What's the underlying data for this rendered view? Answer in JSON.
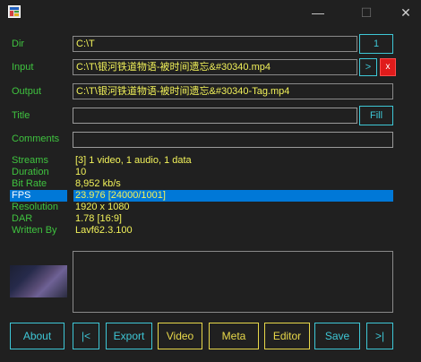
{
  "window": {
    "minimize_glyph": "—",
    "maximize_glyph": "☐",
    "close_glyph": "✕"
  },
  "form": {
    "dir": {
      "label": "Dir",
      "value": "C:\\T",
      "button": "1"
    },
    "input": {
      "label": "Input",
      "value": "C:\\T\\银河铁道物语-被时间遗忘&#30340.mp4",
      "next_button": ">",
      "clear_button": "x"
    },
    "output": {
      "label": "Output",
      "value": "C:\\T\\银河铁道物语-被时间遗忘&#30340-Tag.mp4"
    },
    "title": {
      "label": "Title",
      "value": "",
      "button": "Fill"
    },
    "comments": {
      "label": "Comments",
      "value": ""
    }
  },
  "info": [
    {
      "key": "Streams",
      "value": "[3]  1 video, 1 audio, 1 data"
    },
    {
      "key": "Duration",
      "value": "10"
    },
    {
      "key": "Bit Rate",
      "value": "8,952 kb/s"
    },
    {
      "key": "FPS",
      "value": "23.976  [24000/1001]",
      "selected": true
    },
    {
      "key": "Resolution",
      "value": "1920 x 1080"
    },
    {
      "key": "DAR",
      "value": "1.78  [16:9]"
    },
    {
      "key": "Written By",
      "value": "Lavf62.3.100"
    }
  ],
  "buttons": {
    "about": "About",
    "prev": "|<",
    "export": "Export",
    "video": "Video",
    "meta": "Meta",
    "editor": "Editor",
    "save": "Save",
    "next": ">|"
  },
  "colors": {
    "background": "#202020",
    "label_green": "#3fc33f",
    "value_yellow": "#f2f25a",
    "button_cyan": "#3ec7d6",
    "button_yellow": "#e8d84a",
    "selection_blue": "#0078d7",
    "clear_red": "#e01b1b"
  }
}
